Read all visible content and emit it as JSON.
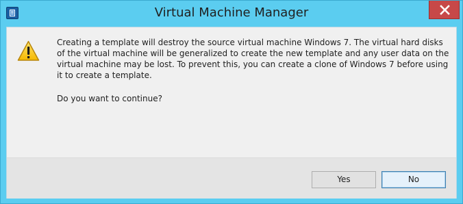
{
  "window": {
    "title": "Virtual Machine Manager",
    "app_icon": "app-icon",
    "close_icon": "close-icon",
    "titlebar_color": "#5bcdf0",
    "close_color": "#c74848"
  },
  "dialog": {
    "icon": "warning-icon",
    "message": "Creating a template will destroy the source virtual machine Windows 7. The virtual hard disks of the virtual machine will be generalized to create the new template and any user data on the virtual machine may be lost. To prevent this, you can create a clone of Windows 7 before using it to create a template.",
    "question": "Do you want to continue?"
  },
  "buttons": {
    "yes_label": "Yes",
    "no_label": "No"
  }
}
